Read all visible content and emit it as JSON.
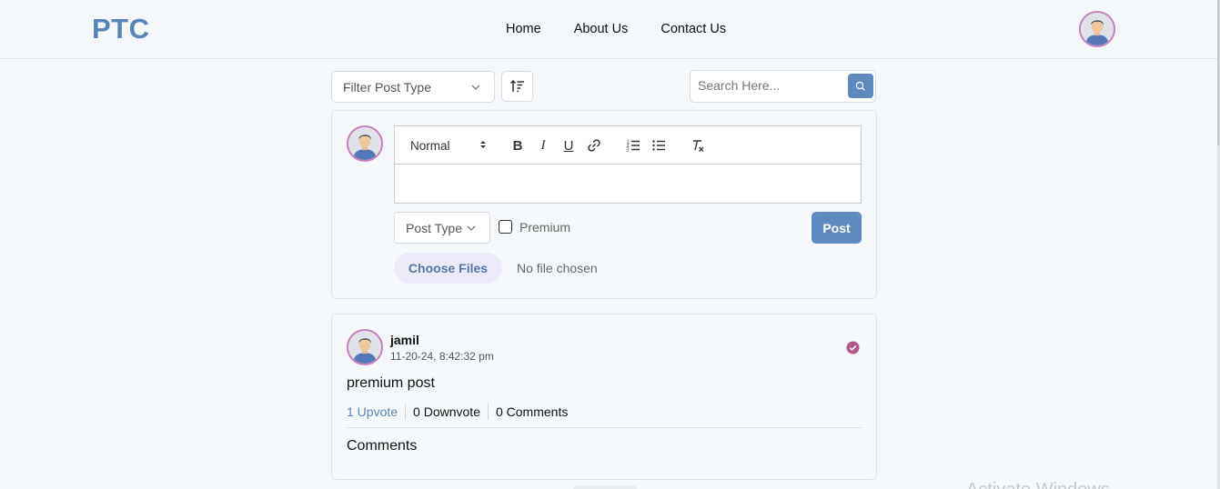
{
  "navbar": {
    "logo": "PTC",
    "links": [
      {
        "label": "Home"
      },
      {
        "label": "About Us"
      },
      {
        "label": "Contact Us"
      }
    ]
  },
  "toolbar": {
    "filter_placeholder": "Filter Post Type",
    "search_placeholder": "Search Here..."
  },
  "composer": {
    "editor": {
      "text_size": "Normal",
      "buttons": [
        "bold",
        "italic",
        "underline",
        "link",
        "ordered-list",
        "bullet-list",
        "clear-formatting"
      ]
    },
    "post_type_placeholder": "Post Type",
    "premium_label": "Premium",
    "premium_checked": false,
    "post_button": "Post",
    "choose_files_button": "Choose Files",
    "file_status": "No file chosen"
  },
  "post": {
    "author": "jamil",
    "timestamp": "11-20-24, 8:42:32 pm",
    "text": "premium post",
    "upvotes": "1 Upvote",
    "downvotes": "0 Downvote",
    "comments_count": "0 Comments",
    "comments_title": "Comments",
    "verified_icon": "check-badge-icon"
  },
  "watermark": "Activate Windows",
  "colors": {
    "accent": "#5f8ac0",
    "logo": "#5a84b6",
    "avatar_border": "#c780b9",
    "verified": "#b5578f",
    "background": "#f4f8fb"
  }
}
